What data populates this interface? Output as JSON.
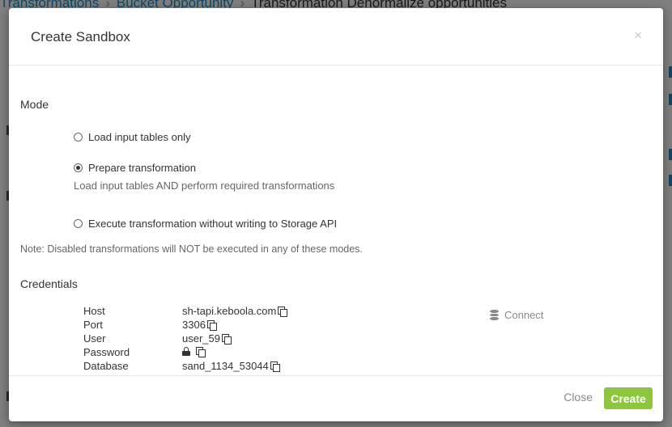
{
  "background": {
    "breadcrumb": [
      {
        "label": "Transformations"
      },
      {
        "label": "Bucket Opportunity"
      },
      {
        "label": "Transformation Denormalize opportunities"
      }
    ],
    "separator": "›"
  },
  "modal": {
    "title": "Create Sandbox",
    "close_icon": "×",
    "mode": {
      "title": "Mode",
      "options": [
        {
          "label": "Load input tables only",
          "checked": false
        },
        {
          "label": "Prepare transformation",
          "checked": true,
          "help": "Load input tables AND perform required transformations"
        },
        {
          "label": "Execute transformation without writing to Storage API",
          "checked": false
        }
      ],
      "note": "Note: Disabled transformations will NOT be executed in any of these modes."
    },
    "credentials": {
      "title": "Credentials",
      "rows": [
        {
          "label": "Host",
          "value": "sh-tapi.keboola.com"
        },
        {
          "label": "Port",
          "value": "3306"
        },
        {
          "label": "User",
          "value": "user_59"
        },
        {
          "label": "Password",
          "value": ""
        },
        {
          "label": "Database",
          "value": "sand_1134_53044"
        }
      ],
      "connect_label": "Connect",
      "connect_icon": "database-icon"
    },
    "footer": {
      "close_label": "Close",
      "create_label": "Create"
    }
  },
  "colors": {
    "accent_green": "#8cc63f",
    "link_blue": "#1f8fc9"
  }
}
